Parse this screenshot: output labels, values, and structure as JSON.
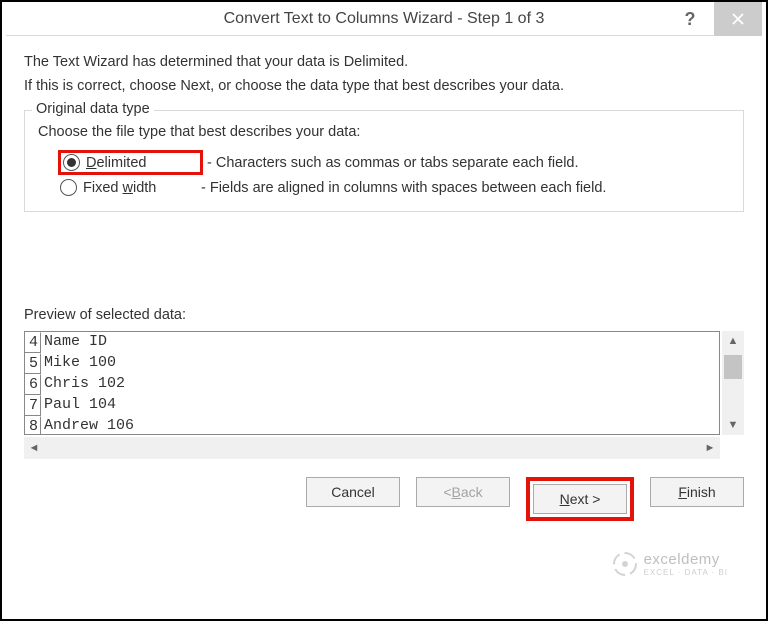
{
  "titlebar": {
    "title": "Convert Text to Columns Wizard - Step 1 of 3",
    "help_label": "?",
    "close_label": "×"
  },
  "description": {
    "line1": "The Text Wizard has determined that your data is Delimited.",
    "line2": "If this is correct, choose Next, or choose the data type that best describes your data."
  },
  "group": {
    "title": "Original data type",
    "instruction": "Choose the file type that best describes your data:",
    "options": [
      {
        "label": "Delimited",
        "desc": "- Characters such as commas or tabs separate each field.",
        "selected": true,
        "highlighted": true
      },
      {
        "label_prefix": "Fixed ",
        "label_underlined": "w",
        "label_suffix": "idth",
        "desc": "- Fields are aligned in columns with spaces between each field.",
        "selected": false,
        "highlighted": false
      }
    ]
  },
  "preview": {
    "label": "Preview of selected data:",
    "rows": [
      {
        "num": "4",
        "text": "Name ID"
      },
      {
        "num": "5",
        "text": "Mike 100"
      },
      {
        "num": "6",
        "text": "Chris 102"
      },
      {
        "num": "7",
        "text": "Paul 104"
      },
      {
        "num": "8",
        "text": "Andrew 106"
      }
    ]
  },
  "buttons": {
    "cancel": "Cancel",
    "back_prefix": "< ",
    "back_u": "B",
    "back_suffix": "ack",
    "next_u": "N",
    "next_suffix": "ext >",
    "finish_u": "F",
    "finish_suffix": "inish"
  },
  "watermark": {
    "brand": "exceldemy",
    "tagline": "EXCEL · DATA · BI"
  }
}
